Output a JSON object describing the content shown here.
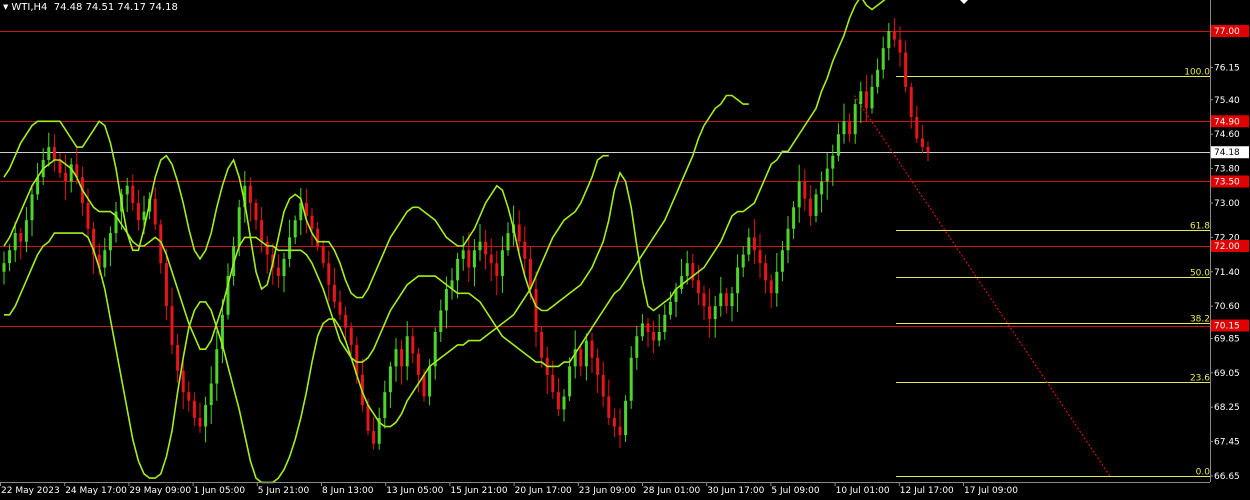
{
  "header": {
    "symbol": "WTI,H4",
    "ohlc": "74.48 74.51 74.17 74.18"
  },
  "colors": {
    "background": "#000000",
    "bull": "#4cd62a",
    "bear": "#e8151b",
    "band": "#a3ef1a",
    "hline_red": "#c8141b",
    "fib": "#e6e85a",
    "price_white": "#ffffff",
    "axis_text": "#ffffff"
  },
  "chart_data": {
    "type": "candlestick",
    "ylim": [
      66.5,
      77.9
    ],
    "y_ticks": [
      "76.15",
      "75.40",
      "74.60",
      "73.80",
      "73.00",
      "72.20",
      "71.40",
      "70.60",
      "69.85",
      "69.05",
      "68.25",
      "67.45",
      "66.65"
    ],
    "x_ticks": [
      "22 May 2023",
      "24 May 17:00",
      "29 May 09:00",
      "1 Jun 05:00",
      "5 Jun 21:00",
      "8 Jun 13:00",
      "13 Jun 05:00",
      "15 Jun 21:00",
      "20 Jun 17:00",
      "23 Jun 09:00",
      "28 Jun 01:00",
      "30 Jun 17:00",
      "5 Jul 09:00",
      "10 Jul 01:00",
      "12 Jul 17:00",
      "17 Jul 09:00"
    ],
    "horizontal_levels": [
      {
        "price": 77.0,
        "label": "77.00",
        "kind": "resistance"
      },
      {
        "price": 74.9,
        "label": "74.90",
        "kind": "resistance"
      },
      {
        "price": 73.5,
        "label": "73.50",
        "kind": "resistance"
      },
      {
        "price": 72.0,
        "label": "72.00",
        "kind": "support"
      },
      {
        "price": 70.15,
        "label": "70.15",
        "kind": "support"
      }
    ],
    "current_price": {
      "price": 74.18,
      "label": "74.18"
    },
    "fibonacci": [
      {
        "level": "100.0",
        "price": 75.95
      },
      {
        "level": "61.8",
        "price": 72.38
      },
      {
        "level": "50.0",
        "price": 71.29
      },
      {
        "level": "38.2",
        "price": 70.2
      },
      {
        "level": "23.6",
        "price": 68.84
      },
      {
        "level": "0.0",
        "price": 66.66
      }
    ],
    "series": {
      "close": [
        71.6,
        71.9,
        72.3,
        72.1,
        72.6,
        73.2,
        73.6,
        74.0,
        74.3,
        74.0,
        73.7,
        73.5,
        73.9,
        73.6,
        73.0,
        72.4,
        71.8,
        71.5,
        71.9,
        72.3,
        72.8,
        73.2,
        73.4,
        73.0,
        72.6,
        72.8,
        73.1,
        72.5,
        71.6,
        70.6,
        69.7,
        69.1,
        68.6,
        68.4,
        68.0,
        67.8,
        68.3,
        68.8,
        69.6,
        70.4,
        71.3,
        72.0,
        72.9,
        73.4,
        73.0,
        72.6,
        72.1,
        71.8,
        71.5,
        71.3,
        71.7,
        72.2,
        72.6,
        73.0,
        72.7,
        72.4,
        72.0,
        71.6,
        71.1,
        70.7,
        70.4,
        70.1,
        69.7,
        69.0,
        68.3,
        67.7,
        67.4,
        68.0,
        68.6,
        69.2,
        69.6,
        69.2,
        69.9,
        69.5,
        69.0,
        68.5,
        69.2,
        70.0,
        70.5,
        71.0,
        71.2,
        71.7,
        71.9,
        71.5,
        71.9,
        72.1,
        71.8,
        71.6,
        71.3,
        71.9,
        72.3,
        72.5,
        72.1,
        71.7,
        71.0,
        70.0,
        69.4,
        69.0,
        68.6,
        68.2,
        68.5,
        69.2,
        69.6,
        69.2,
        69.8,
        69.4,
        69.0,
        68.5,
        68.0,
        67.8,
        67.6,
        68.4,
        69.4,
        69.9,
        70.2,
        70.0,
        69.8,
        70.0,
        70.4,
        70.7,
        71.0,
        71.3,
        71.6,
        71.2,
        70.9,
        70.6,
        70.3,
        70.6,
        70.9,
        70.6,
        70.9,
        71.5,
        71.8,
        72.2,
        71.9,
        71.6,
        71.2,
        70.9,
        71.4,
        71.9,
        72.4,
        72.9,
        73.5,
        73.1,
        72.7,
        73.2,
        73.5,
        73.8,
        74.1,
        74.6,
        74.9,
        74.6,
        75.3,
        75.6,
        75.2,
        75.7,
        76.1,
        76.6,
        77.0,
        76.8,
        76.5,
        75.7,
        75.0,
        74.5,
        74.3,
        74.18
      ],
      "bb_upper": [
        73.6,
        73.8,
        74.1,
        74.4,
        74.6,
        74.8,
        74.9,
        74.9,
        74.9,
        74.9,
        74.9,
        74.7,
        74.5,
        74.3,
        74.3,
        74.5,
        74.7,
        74.9,
        74.8,
        74.4,
        73.8,
        73.0,
        72.3,
        71.9,
        71.9,
        72.4,
        73.0,
        73.6,
        74.0,
        74.1,
        73.9,
        73.5,
        73.0,
        72.4,
        71.9,
        71.7,
        71.9,
        72.3,
        72.9,
        73.4,
        73.8,
        74.0,
        73.6,
        73.0,
        72.2,
        71.4,
        71.0,
        71.1,
        71.6,
        72.2,
        72.8,
        73.1,
        73.2,
        73.1,
        72.6,
        72.3,
        72.1,
        72.1,
        72.1,
        71.9,
        71.6,
        71.2,
        70.9,
        70.8,
        70.8,
        71.0,
        71.3,
        71.6,
        71.9,
        72.2,
        72.4,
        72.6,
        72.8,
        72.9,
        72.9,
        72.8,
        72.7,
        72.6,
        72.4,
        72.2,
        72.1,
        72.0,
        72.0,
        72.2,
        72.4,
        72.7,
        73.0,
        73.2,
        73.4,
        73.3,
        72.9,
        72.4,
        71.8,
        71.3,
        70.9,
        70.6,
        70.5,
        70.5,
        70.6,
        70.7,
        70.8,
        70.9,
        71.0,
        71.1,
        71.3,
        71.5,
        71.8,
        72.1,
        72.6,
        73.3,
        73.7,
        73.5,
        72.9,
        72.0,
        71.2,
        70.6,
        70.5,
        70.6,
        70.7,
        70.8,
        71.0,
        71.1,
        71.2,
        71.3,
        71.4,
        71.5,
        71.7,
        71.9,
        72.1,
        72.4,
        72.7,
        72.8,
        72.8,
        72.9,
        73.0,
        73.3,
        73.6,
        73.9,
        74.0,
        74.2,
        74.2,
        74.4,
        74.6,
        74.8,
        75.0,
        75.2,
        75.6,
        75.9,
        76.3,
        76.6,
        76.9,
        77.3,
        77.6,
        77.8,
        77.6,
        77.5,
        77.6,
        77.7,
        77.8
      ],
      "bb_mid": [
        72.0,
        72.2,
        72.5,
        72.8,
        73.1,
        73.4,
        73.6,
        73.8,
        73.9,
        74.0,
        74.0,
        73.9,
        73.8,
        73.6,
        73.3,
        73.1,
        72.9,
        72.8,
        72.8,
        72.8,
        72.7,
        72.5,
        72.3,
        72.1,
        72.0,
        72.0,
        72.1,
        72.2,
        72.1,
        71.8,
        71.4,
        71.0,
        70.6,
        70.2,
        69.9,
        69.6,
        69.6,
        69.8,
        70.2,
        70.6,
        71.1,
        71.6,
        72.0,
        72.2,
        72.2,
        72.2,
        72.1,
        72.0,
        72.0,
        71.9,
        71.9,
        71.9,
        71.9,
        71.9,
        71.8,
        71.6,
        71.3,
        71.0,
        70.6,
        70.2,
        69.8,
        69.6,
        69.4,
        69.3,
        69.3,
        69.4,
        69.6,
        69.9,
        70.2,
        70.5,
        70.7,
        70.9,
        71.1,
        71.2,
        71.3,
        71.3,
        71.3,
        71.3,
        71.2,
        71.1,
        71.0,
        70.9,
        70.9,
        70.9,
        70.8,
        70.7,
        70.5,
        70.3,
        70.1,
        69.9,
        69.8,
        69.7,
        69.6,
        69.5,
        69.4,
        69.3,
        69.3,
        69.2,
        69.2,
        69.2,
        69.3,
        69.3,
        69.5,
        69.7,
        69.9,
        70.1,
        70.3,
        70.5,
        70.7,
        70.9,
        71.0,
        71.2,
        71.4,
        71.6,
        71.8,
        72.0,
        72.2,
        72.4,
        72.6,
        72.9,
        73.2,
        73.5,
        73.8,
        74.1,
        74.5,
        74.8,
        75.0,
        75.2,
        75.3,
        75.5,
        75.5,
        75.4,
        75.3,
        75.3
      ],
      "bb_lower": [
        70.4,
        70.4,
        70.6,
        70.9,
        71.2,
        71.5,
        71.8,
        72.0,
        72.1,
        72.3,
        72.3,
        72.3,
        72.3,
        72.3,
        72.3,
        72.2,
        71.9,
        71.5,
        71.0,
        70.3,
        69.6,
        68.9,
        68.2,
        67.5,
        67.0,
        66.7,
        66.6,
        66.6,
        66.7,
        67.1,
        67.7,
        68.6,
        69.4,
        70.1,
        70.5,
        70.7,
        70.7,
        70.5,
        70.1,
        69.7,
        69.2,
        68.7,
        68.2,
        67.6,
        67.0,
        66.6,
        66.5,
        66.5,
        66.5,
        66.6,
        66.8,
        67.1,
        67.5,
        68.0,
        68.6,
        69.3,
        69.9,
        70.2,
        70.3,
        70.3,
        70.1,
        69.8,
        69.4,
        69.0,
        68.6,
        68.3,
        68.1,
        67.9,
        67.8,
        67.8,
        67.9,
        68.1,
        68.4,
        68.6,
        68.8,
        69.0,
        69.2,
        69.3,
        69.4,
        69.5,
        69.6,
        69.7,
        69.7,
        69.8,
        69.8,
        69.8,
        69.9,
        70.0,
        70.1,
        70.2,
        70.3,
        70.4,
        70.6,
        70.8,
        71.0,
        71.3,
        71.6,
        71.9,
        72.2,
        72.4,
        72.6,
        72.7,
        72.8,
        73.0,
        73.3,
        73.6,
        74.0,
        74.1,
        74.1
      ]
    }
  }
}
